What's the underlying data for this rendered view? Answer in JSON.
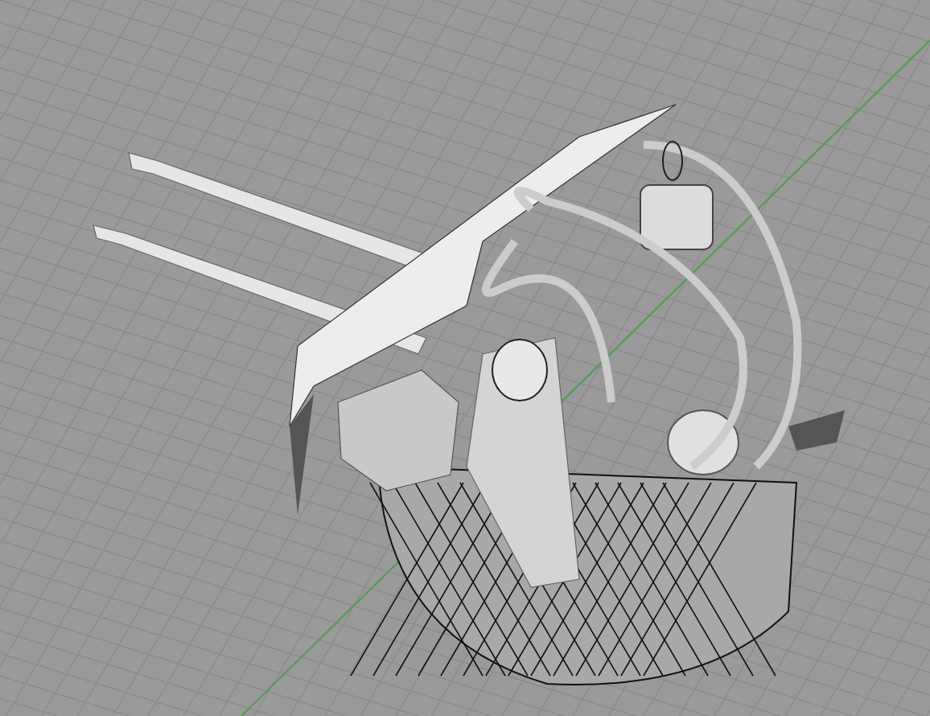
{
  "viewport": {
    "axes": [
      {
        "kind": "y",
        "color": "#5a9a5a"
      }
    ]
  }
}
